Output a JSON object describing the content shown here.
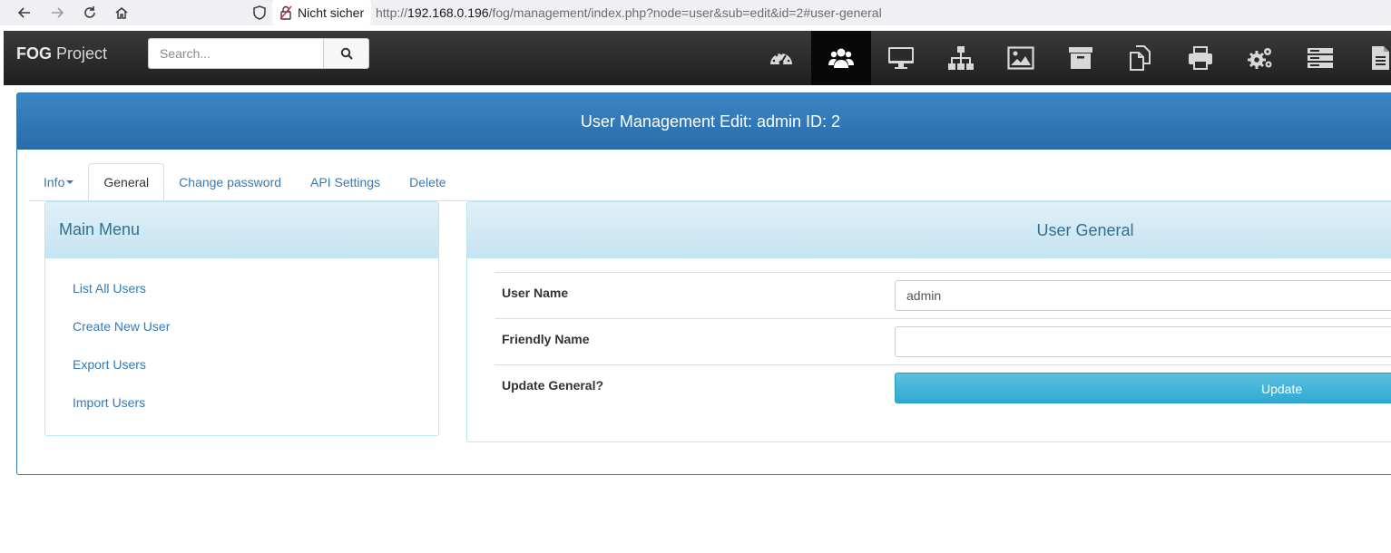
{
  "browser": {
    "security_label": "Nicht sicher",
    "url_prefix": "http://",
    "url_host": "192.168.0.196",
    "url_path": "/fog/management/index.php?node=user&sub=edit&id=2#user-general"
  },
  "navbar": {
    "brand_bold": "FOG",
    "brand_rest": " Project",
    "search_placeholder": "Search...",
    "icons": [
      "dashboard-icon",
      "users-icon",
      "hosts-icon",
      "groups-icon",
      "images-icon",
      "storage-icon",
      "snapins-icon",
      "printers-icon",
      "service-icon",
      "tasks-icon",
      "reports-icon"
    ],
    "active_icon": "users-icon"
  },
  "page": {
    "title": "User Management Edit: admin ID: 2"
  },
  "tabs": [
    {
      "label": "Info",
      "has_caret": true
    },
    {
      "label": "General",
      "active": true
    },
    {
      "label": "Change password"
    },
    {
      "label": "API Settings"
    },
    {
      "label": "Delete"
    }
  ],
  "main_menu": {
    "title": "Main Menu",
    "items": [
      "List All Users",
      "Create New User",
      "Export Users",
      "Import Users"
    ]
  },
  "user_general": {
    "title": "User General",
    "user_name_label": "User Name",
    "user_name_value": "admin",
    "friendly_name_label": "Friendly Name",
    "friendly_name_value": "",
    "update_label": "Update General?",
    "update_button": "Update"
  },
  "colors": {
    "navbar_bg": "#2b2b2b",
    "primary": "#337ab7",
    "info_head": "#d9edf7",
    "info_button": "#5bc0de"
  }
}
